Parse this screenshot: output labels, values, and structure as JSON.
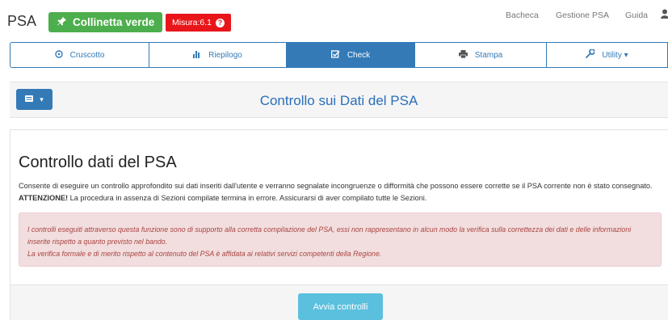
{
  "brand": "PSA",
  "badge_green": {
    "icon": "pin-icon",
    "label": "Collinetta verde",
    "color": "#4cae4c"
  },
  "badge_red": {
    "label": "Misura:6.1",
    "icon": "question-circle-icon",
    "color": "#e8161a"
  },
  "topnav": {
    "items": [
      "Bacheca",
      "Gestione PSA",
      "Guida"
    ],
    "user_icon": "user-icon"
  },
  "tabs": [
    {
      "label": "Cruscotto",
      "icon": "dashboard-icon",
      "glyph": "⊙",
      "active": false
    },
    {
      "label": "Riepilogo",
      "icon": "bar-chart-icon",
      "glyph": "▐",
      "active": false
    },
    {
      "label": "Check",
      "icon": "check-square-icon",
      "glyph": "☑",
      "active": true
    },
    {
      "label": "Stampa",
      "icon": "print-icon",
      "glyph": "🖶",
      "active": false
    },
    {
      "label": "Utility ▾",
      "icon": "wrench-icon",
      "glyph": "✗",
      "active": false
    }
  ],
  "header": {
    "title": "Controllo sui Dati del PSA",
    "menu_icon": "menu-icon"
  },
  "panel": {
    "title": "Controllo dati del PSA",
    "desc_part1": "Consente di eseguire un controllo approfondito sui dati inseriti dall'utente e verranno segnalate incongruenze o difformità che possono essere corrette se il PSA corrente non è stato consegnato. ",
    "desc_strong": "ATTENZIONE!",
    "desc_part2": " La procedura in assenza di Sezioni compilate termina in errore. Assicurarsi di aver compilato tutte le Sezioni.",
    "alert_line1": "I controlli eseguiti attraverso questa funzione sono di supporto alla corretta compilazione del PSA, essi non rappresentano in alcun modo la verifica sulla correttezza dei dati e delle informazioni inserite rispetto a quanto previsto nel bando.",
    "alert_line2": "La verifica formale e di merito rispetto al contenuto del PSA è affidata ai relativi servizi competenti della Regione."
  },
  "footer": {
    "button_label": "Avvia controlli"
  },
  "colors": {
    "primary": "#337ab7",
    "info": "#5bc0de",
    "alert_bg": "#f2dede",
    "alert_text": "#a94442"
  }
}
